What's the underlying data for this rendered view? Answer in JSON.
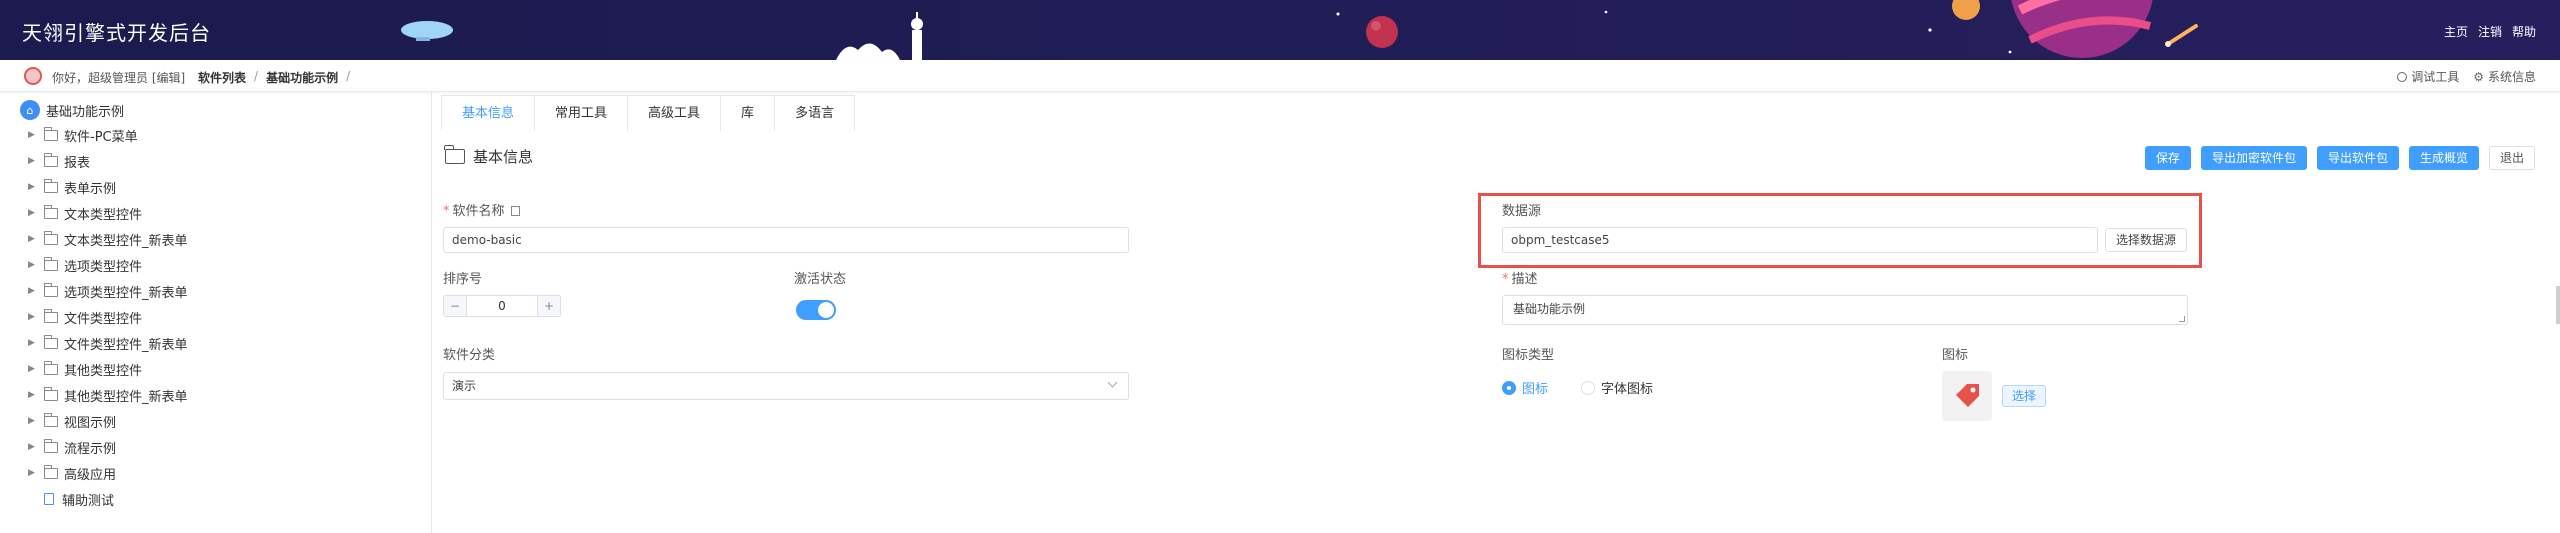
{
  "header": {
    "title": "天翎引擎式开发后台",
    "links": [
      "主页",
      "注销",
      "帮助"
    ]
  },
  "crumbbar": {
    "greeting": "你好，超级管理员 [编辑]",
    "crumbs": [
      "软件列表",
      "基础功能示例"
    ],
    "separator": "/",
    "right": {
      "debug_tool": "调试工具",
      "system_info": "系统信息"
    }
  },
  "sidebar": {
    "root": "基础功能示例",
    "items": [
      {
        "label": "软件-PC菜单",
        "type": "folder"
      },
      {
        "label": "报表",
        "type": "folder"
      },
      {
        "label": "表单示例",
        "type": "folder"
      },
      {
        "label": "文本类型控件",
        "type": "folder"
      },
      {
        "label": "文本类型控件_新表单",
        "type": "folder"
      },
      {
        "label": "选项类型控件",
        "type": "folder"
      },
      {
        "label": "选项类型控件_新表单",
        "type": "folder"
      },
      {
        "label": "文件类型控件",
        "type": "folder"
      },
      {
        "label": "文件类型控件_新表单",
        "type": "folder"
      },
      {
        "label": "其他类型控件",
        "type": "folder"
      },
      {
        "label": "其他类型控件_新表单",
        "type": "folder"
      },
      {
        "label": "视图示例",
        "type": "folder"
      },
      {
        "label": "流程示例",
        "type": "folder"
      },
      {
        "label": "高级应用",
        "type": "folder"
      },
      {
        "label": "辅助测试",
        "type": "file"
      }
    ]
  },
  "tabs": [
    {
      "label": "基本信息",
      "active": true
    },
    {
      "label": "常用工具",
      "active": false
    },
    {
      "label": "高级工具",
      "active": false
    },
    {
      "label": "库",
      "active": false
    },
    {
      "label": "多语言",
      "active": false
    }
  ],
  "section_title": "基本信息",
  "toolbar": {
    "save": "保存",
    "export_encrypted": "导出加密软件包",
    "export_package": "导出软件包",
    "generate_summary": "生成概览",
    "exit": "退出"
  },
  "form": {
    "software_name_label": "软件名称",
    "software_name_value": "demo-basic",
    "sort_label": "排序号",
    "sort_value": "0",
    "active_label": "激活状态",
    "active_value": true,
    "category_label": "软件分类",
    "category_value": "演示",
    "datasource_label": "数据源",
    "datasource_value": "obpm_testcase5",
    "datasource_button": "选择数据源",
    "description_label": "描述",
    "description_value": "基础功能示例",
    "icon_type_label": "图标类型",
    "icon_type_options": [
      "图标",
      "字体图标"
    ],
    "icon_type_selected": "图标",
    "icon_label": "图标",
    "icon_select_button": "选择"
  },
  "colors": {
    "header_bg": "#1f1b55",
    "accent": "#409eff",
    "highlight": "#e8504a",
    "tag_icon": "#e8504a"
  }
}
